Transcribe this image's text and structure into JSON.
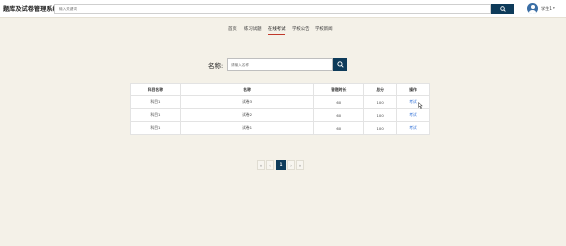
{
  "header": {
    "logo_text": "题库及试卷管理系统",
    "search_placeholder": "输入关键词",
    "search_button_icon": "search-icon",
    "user_avatar_icon": "user-avatar-icon",
    "user_name": "学生1",
    "user_caret_icon": "caret-down-icon"
  },
  "nav": {
    "items": [
      {
        "label": "首页"
      },
      {
        "label": "练习试题"
      },
      {
        "label": "在线考试"
      },
      {
        "label": "学校公告"
      },
      {
        "label": "学校新闻"
      }
    ],
    "active_index": 2
  },
  "filter": {
    "label": "名称:",
    "placeholder": "请输入名称",
    "button_icon": "search-icon"
  },
  "table": {
    "headers": [
      "科目名称",
      "名称",
      "答题时长",
      "总分",
      "操作"
    ],
    "rows": [
      {
        "subject": "科目1",
        "name": "试卷3",
        "duration": "60",
        "score": "100",
        "action": "考试"
      },
      {
        "subject": "科目1",
        "name": "试卷2",
        "duration": "60",
        "score": "100",
        "action": "考试"
      },
      {
        "subject": "科目1",
        "name": "试卷1",
        "duration": "60",
        "score": "100",
        "action": "考试"
      }
    ]
  },
  "pagination": {
    "first": "«",
    "prev": "‹",
    "current": "1",
    "next": "›",
    "last": "»"
  },
  "colors": {
    "primary": "#0e3b5a",
    "background": "#f4f1e8",
    "link": "#2f6fd6",
    "nav_active_underline": "#c0392b"
  }
}
